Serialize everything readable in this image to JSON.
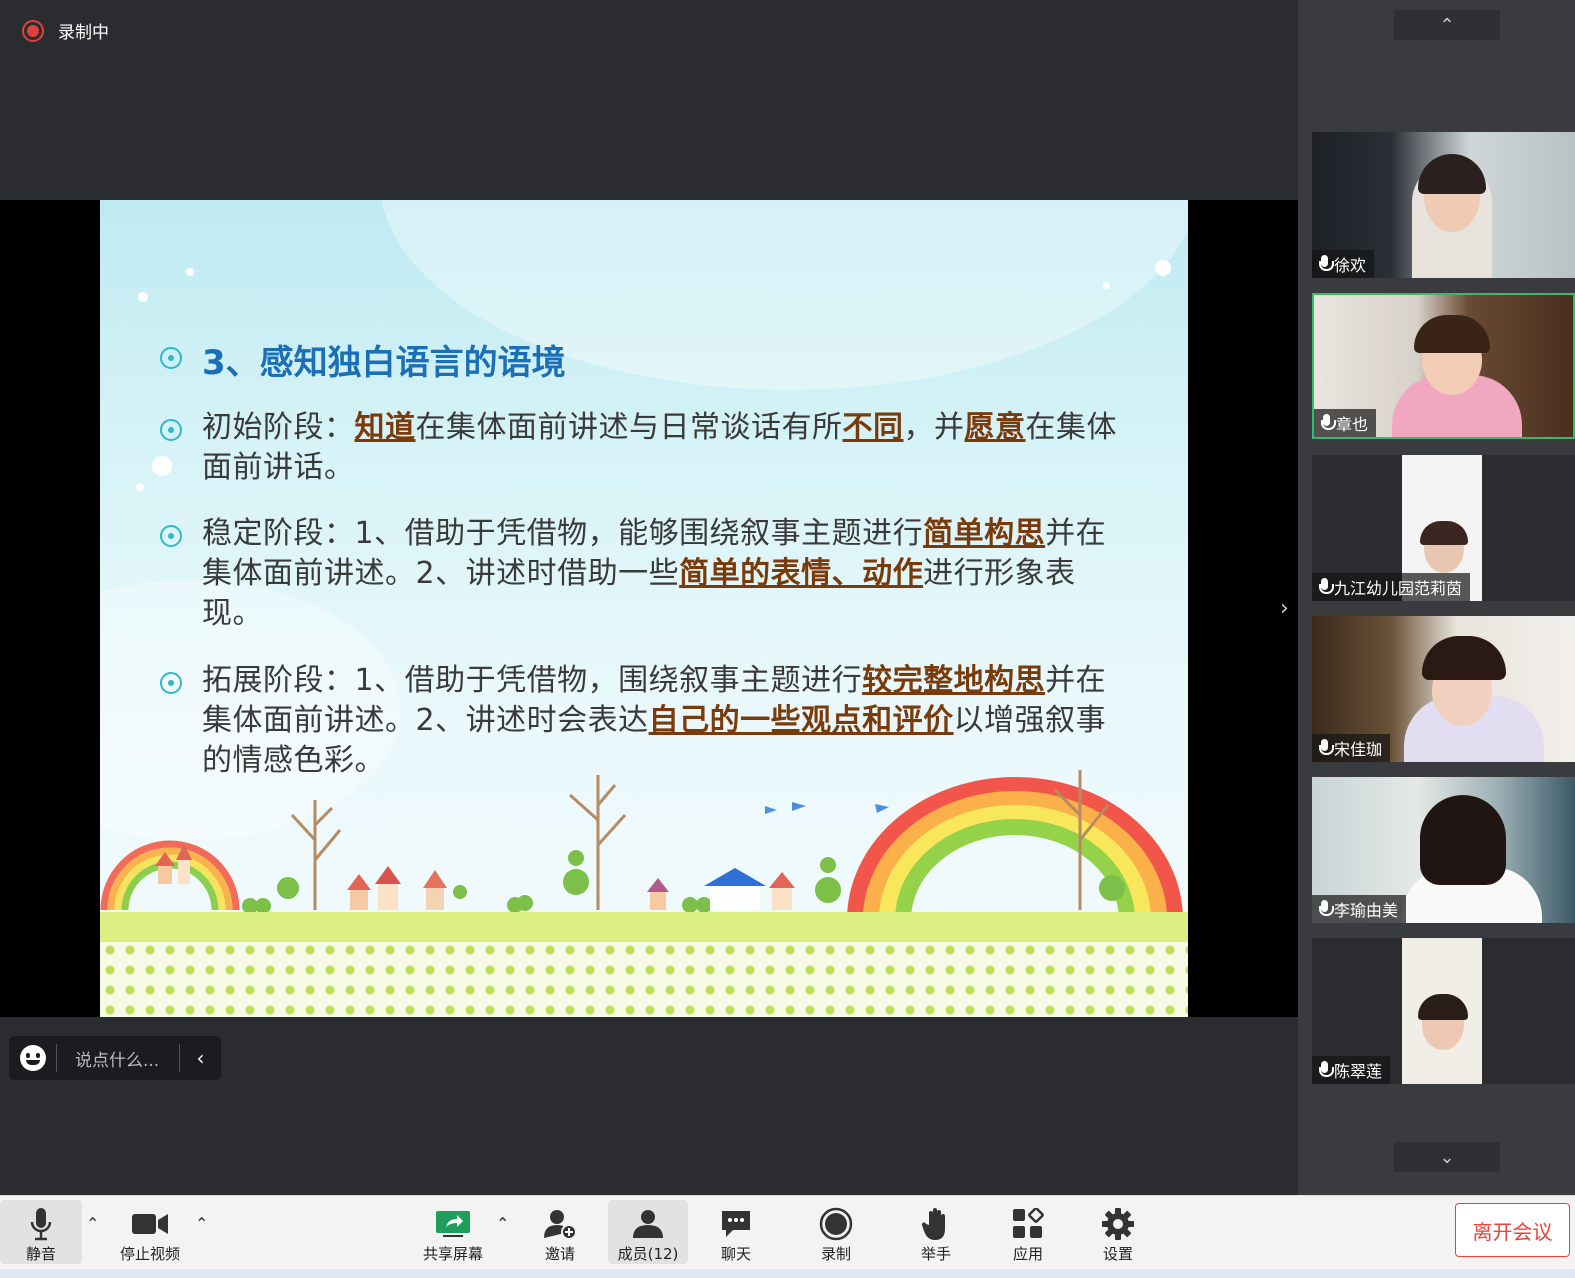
{
  "recording": {
    "label": "录制中"
  },
  "slide": {
    "title": "3、感知独白语言的语境",
    "items": [
      {
        "parts": [
          {
            "t": "初始阶段："
          },
          {
            "t": "知道",
            "k": 1
          },
          {
            "t": "在集体面前讲述与日常谈话有所"
          },
          {
            "t": "不同",
            "k": 1
          },
          {
            "t": "，并"
          },
          {
            "t": "愿意",
            "k": 1
          },
          {
            "t": "在集体面前讲话。"
          }
        ]
      },
      {
        "parts": [
          {
            "t": "稳定阶段：1、借助于凭借物，能够围绕叙事主题进行"
          },
          {
            "t": "简单构思",
            "k": 1
          },
          {
            "t": "并在集体面前讲述。2、讲述时借助一些"
          },
          {
            "t": "简单的表情、动作",
            "k": 1
          },
          {
            "t": "进行形象表现。"
          }
        ]
      },
      {
        "parts": [
          {
            "t": "拓展阶段：1、借助于凭借物，围绕叙事主题进行"
          },
          {
            "t": "较完整地构思",
            "k": 1
          },
          {
            "t": "并在集体面前讲述。2、讲述时会表达"
          },
          {
            "t": "自己的一些观点和评价",
            "k": 1
          },
          {
            "t": "以增强叙事的情感色彩。"
          }
        ]
      }
    ]
  },
  "chat": {
    "placeholder": "说点什么..."
  },
  "participants": [
    {
      "name": "徐欢",
      "active": false
    },
    {
      "name": "章也",
      "active": true
    },
    {
      "name": "九江幼儿园范莉茵",
      "active": false
    },
    {
      "name": "宋佳珈",
      "active": false
    },
    {
      "name": "李瑜由美",
      "active": false
    },
    {
      "name": "陈翠莲",
      "active": false
    }
  ],
  "toolbar": {
    "mute": "静音",
    "video": "停止视频",
    "share": "共享屏幕",
    "invite": "邀请",
    "members": "成员(12)",
    "chat": "聊天",
    "record": "录制",
    "raise_hand": "举手",
    "apps": "应用",
    "settings": "设置",
    "leave": "离开会议"
  },
  "colors": {
    "accent_green": "#2ebf6a",
    "leave_red": "#e6453b",
    "title_blue": "#1b6fb7",
    "keyword_brown": "#7a3b0c"
  }
}
